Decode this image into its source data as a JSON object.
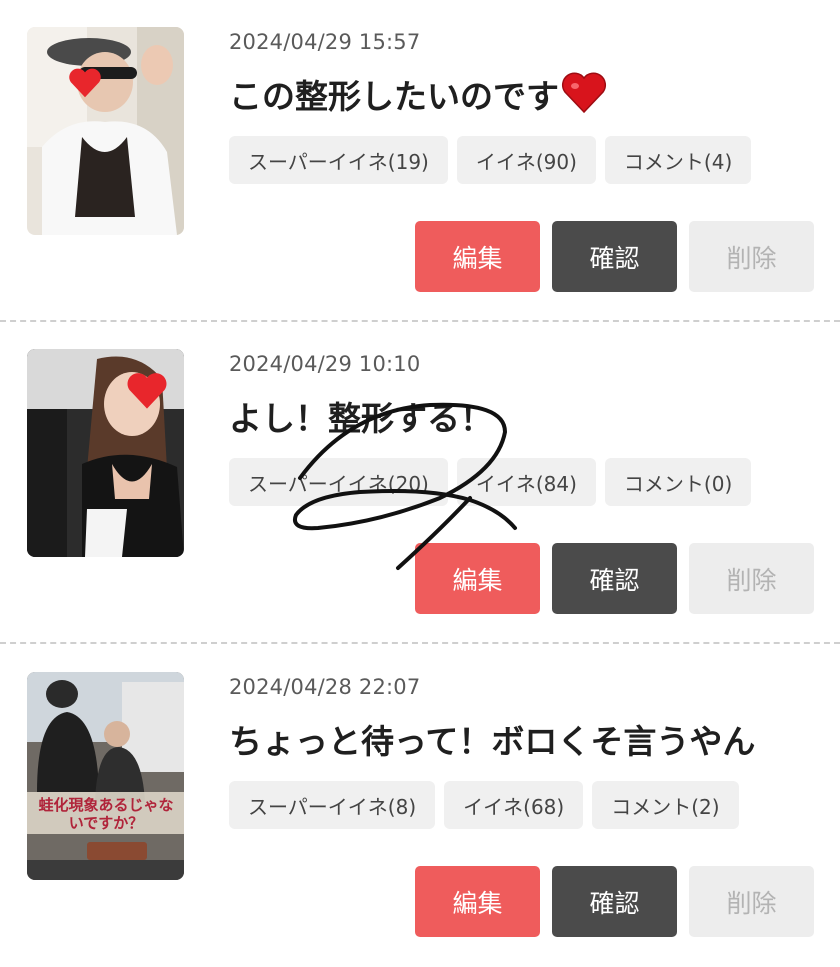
{
  "posts": [
    {
      "date": "2024/04/29 15:57",
      "title": "この整形したいのです",
      "has_heart": true,
      "chips": {
        "super_like": "スーパーイイネ(19)",
        "like": "イイネ(90)",
        "comment": "コメント(4)"
      },
      "buttons": {
        "edit": "編集",
        "confirm": "確認",
        "delete": "削除"
      }
    },
    {
      "date": "2024/04/29 10:10",
      "title": "よし！整形する！",
      "has_heart": false,
      "chips": {
        "super_like": "スーパーイイネ(20)",
        "like": "イイネ(84)",
        "comment": "コメント(0)"
      },
      "buttons": {
        "edit": "編集",
        "confirm": "確認",
        "delete": "削除"
      }
    },
    {
      "date": "2024/04/28 22:07",
      "title": "ちょっと待って！ボロくそ言うやん",
      "has_heart": false,
      "chips": {
        "super_like": "スーパーイイネ(8)",
        "like": "イイネ(68)",
        "comment": "コメント(2)"
      },
      "buttons": {
        "edit": "編集",
        "confirm": "確認",
        "delete": "削除"
      }
    }
  ],
  "thumbnail_3_caption": "蛙化現象あるじゃないですか？",
  "colors": {
    "edit": "#ef5c5c",
    "confirm": "#4b4b4b",
    "delete": "#ededed",
    "chip": "#f0f0f0"
  },
  "icons": [
    "heart-emoji-icon",
    "handwritten-number-2-scribble"
  ]
}
